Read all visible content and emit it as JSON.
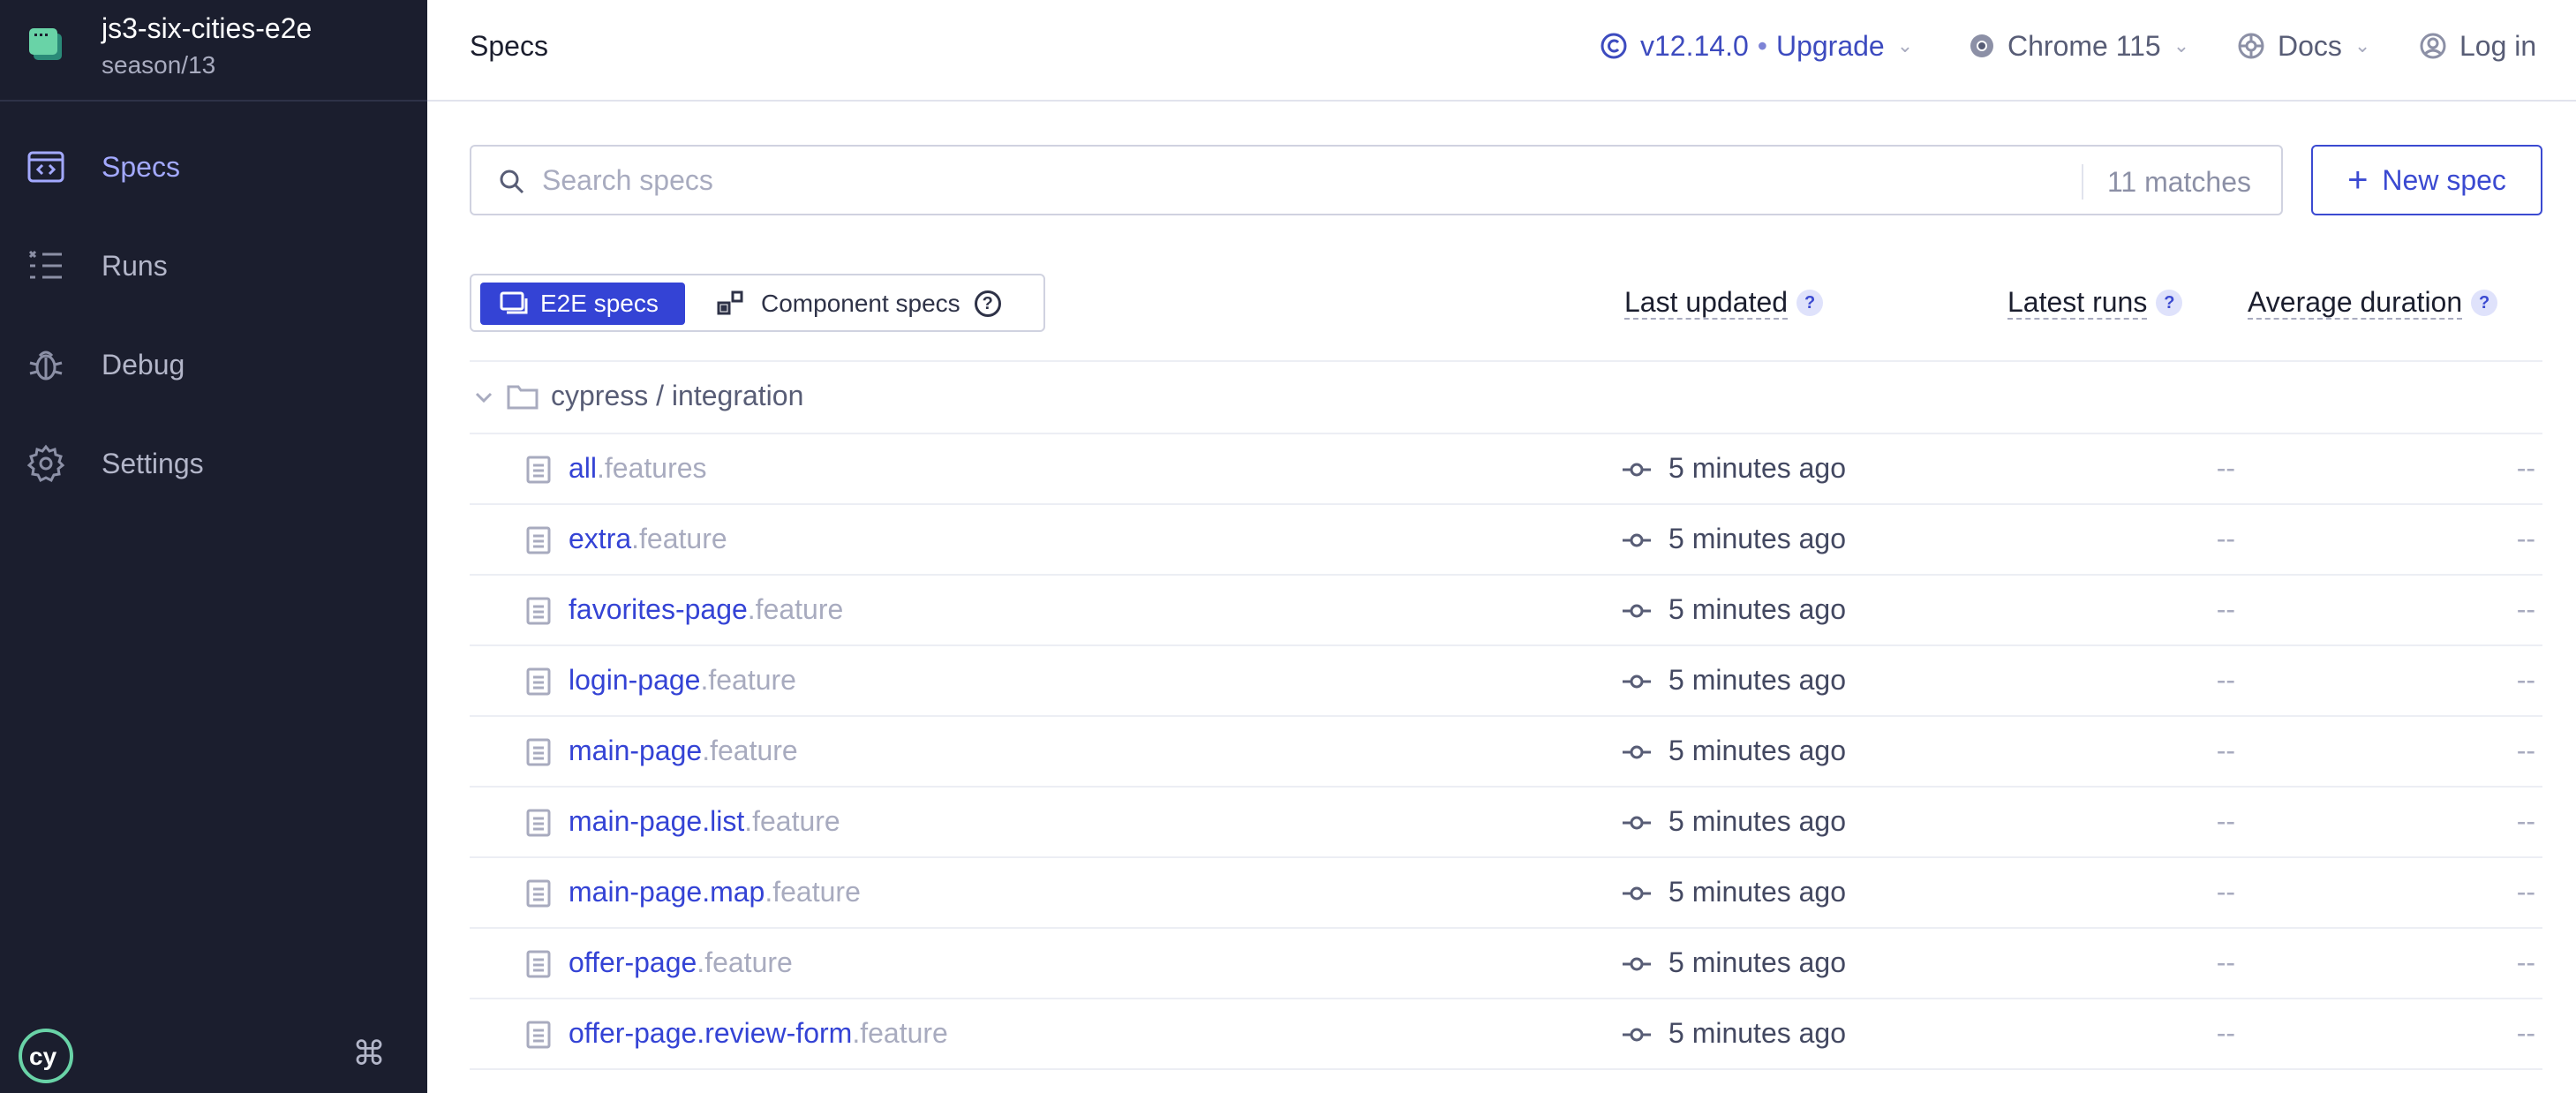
{
  "project": {
    "name": "js3-six-cities-e2e",
    "branch": "season/13"
  },
  "sidebar": {
    "items": [
      {
        "label": "Specs",
        "icon": "specs-icon",
        "active": true
      },
      {
        "label": "Runs",
        "icon": "runs-icon",
        "active": false
      },
      {
        "label": "Debug",
        "icon": "debug-icon",
        "active": false
      },
      {
        "label": "Settings",
        "icon": "gear-icon",
        "active": false
      }
    ],
    "shortcut_icon": "⌘"
  },
  "header": {
    "title": "Specs",
    "version": "v12.14.0",
    "version_sep": "•",
    "upgrade": "Upgrade",
    "browser": "Chrome 115",
    "docs": "Docs",
    "login": "Log in"
  },
  "search": {
    "placeholder": "Search specs",
    "value": "",
    "matches": "11 matches"
  },
  "new_spec": {
    "label": "New spec"
  },
  "toggle": {
    "e2e": "E2E specs",
    "component": "Component specs",
    "help": "?"
  },
  "columns": {
    "last_updated": "Last updated",
    "latest_runs": "Latest runs",
    "average_duration": "Average duration",
    "help": "?"
  },
  "folder": {
    "label": "cypress / integration"
  },
  "specs": [
    {
      "base": "all",
      "ext": ".features",
      "updated": "5 minutes ago",
      "runs": "--",
      "duration": "--"
    },
    {
      "base": "extra",
      "ext": ".feature",
      "updated": "5 minutes ago",
      "runs": "--",
      "duration": "--"
    },
    {
      "base": "favorites-page",
      "ext": ".feature",
      "updated": "5 minutes ago",
      "runs": "--",
      "duration": "--"
    },
    {
      "base": "login-page",
      "ext": ".feature",
      "updated": "5 minutes ago",
      "runs": "--",
      "duration": "--"
    },
    {
      "base": "main-page",
      "ext": ".feature",
      "updated": "5 minutes ago",
      "runs": "--",
      "duration": "--"
    },
    {
      "base": "main-page.list",
      "ext": ".feature",
      "updated": "5 minutes ago",
      "runs": "--",
      "duration": "--"
    },
    {
      "base": "main-page.map",
      "ext": ".feature",
      "updated": "5 minutes ago",
      "runs": "--",
      "duration": "--"
    },
    {
      "base": "offer-page",
      "ext": ".feature",
      "updated": "5 minutes ago",
      "runs": "--",
      "duration": "--"
    },
    {
      "base": "offer-page.review-form",
      "ext": ".feature",
      "updated": "5 minutes ago",
      "runs": "--",
      "duration": "--"
    }
  ],
  "colors": {
    "sidebar_bg": "#1b1e2e",
    "accent": "#3443d5",
    "active_nav": "#a3a9ff",
    "muted": "#a8abbf"
  }
}
